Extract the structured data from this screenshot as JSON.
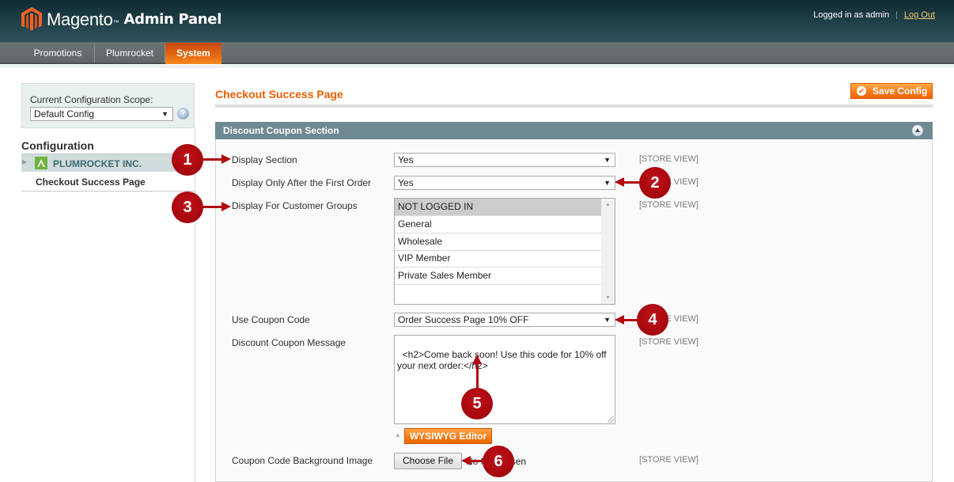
{
  "header": {
    "logo_text": "Magento",
    "logo_tm": "™",
    "logo_sub": "Admin Panel",
    "logged_in_text": "Logged in as admin",
    "separator": "|",
    "logout_label": "Log Out"
  },
  "nav": {
    "items": [
      {
        "label": "Promotions",
        "active": false
      },
      {
        "label": "Plumrocket",
        "active": false
      },
      {
        "label": "System",
        "active": true
      }
    ]
  },
  "sidebar": {
    "scope_label": "Current Configuration Scope:",
    "scope_value": "Default Config",
    "help_icon": "?",
    "config_title": "Configuration",
    "group_label": "PLUMROCKET INC.",
    "item_label": "Checkout Success Page"
  },
  "main": {
    "page_title": "Checkout Success Page",
    "save_label": "Save Config",
    "save_icon": "✔",
    "section_title": "Discount Coupon Section",
    "scope_tag": "[STORE VIEW]",
    "fields": {
      "display_section": {
        "label": "Display Section",
        "value": "Yes"
      },
      "display_after_first_order": {
        "label": "Display Only After the First Order",
        "value": "Yes"
      },
      "customer_groups": {
        "label": "Display For Customer Groups",
        "options": [
          "NOT LOGGED IN",
          "General",
          "Wholesale",
          "VIP Member",
          "Private Sales Member"
        ],
        "selected": "NOT LOGGED IN"
      },
      "use_coupon_code": {
        "label": "Use Coupon Code",
        "value": "Order Success Page 10% OFF"
      },
      "coupon_message": {
        "label": "Discount Coupon Message",
        "value": "<h2>Come back soon! Use this code for 10% off your next order:</h2>"
      },
      "wysiwyg_label": "WYSIWYG Editor",
      "background_image": {
        "label": "Coupon Code Background Image",
        "button_label": "Choose File",
        "status": "No file chosen"
      }
    }
  },
  "annotations": [
    {
      "number": "1",
      "target": "Display Section"
    },
    {
      "number": "2",
      "target": "Display Only After the First Order"
    },
    {
      "number": "3",
      "target": "Display For Customer Groups"
    },
    {
      "number": "4",
      "target": "Use Coupon Code"
    },
    {
      "number": "5",
      "target": "Discount Coupon Message"
    },
    {
      "number": "6",
      "target": "Coupon Code Background Image"
    }
  ],
  "colors": {
    "accent_orange": "#eb5e00",
    "section_header": "#6f8992",
    "callout_red": "#a5060d"
  }
}
